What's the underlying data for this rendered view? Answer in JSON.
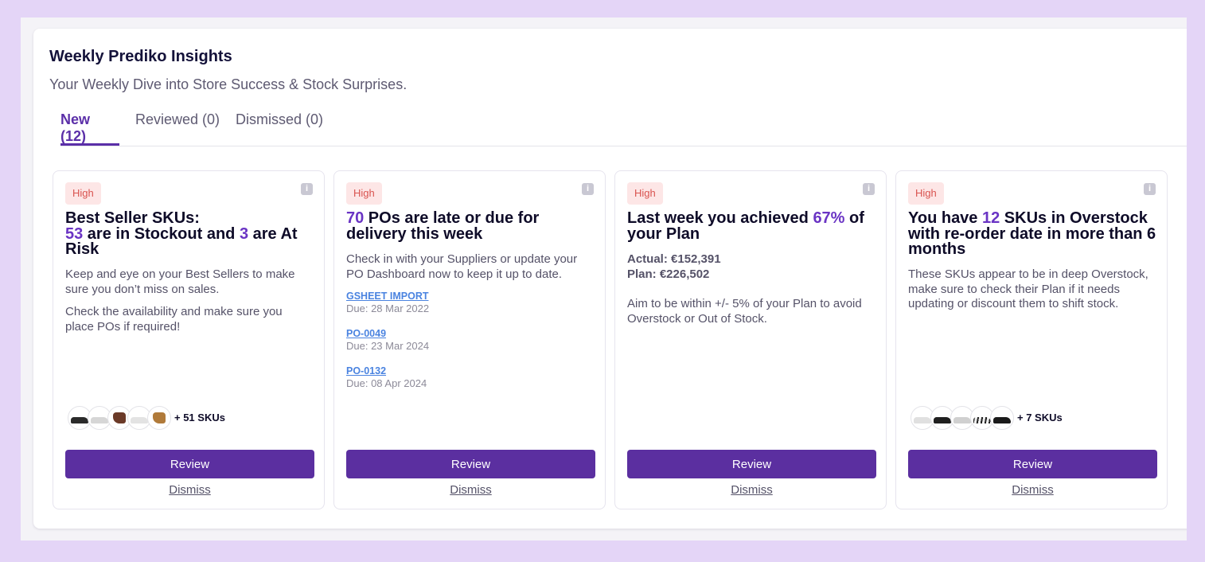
{
  "panel": {
    "title": "Weekly Prediko Insights",
    "subtitle": "Your Weekly Dive into Store Success & Stock Surprises."
  },
  "tabs": [
    {
      "label": "New (12)",
      "active": true
    },
    {
      "label": "Reviewed (0)",
      "active": false
    },
    {
      "label": "Dismissed (0)",
      "active": false
    }
  ],
  "colors": {
    "accent": "#5b2fa8",
    "highlight": "#6a34c4",
    "button": "#5b2fa0",
    "badge_text": "#d9534f",
    "badge_bg": "#fde6e6",
    "link": "#4a83e0"
  },
  "cards": [
    {
      "badge": "High",
      "info_icon": "info-icon",
      "heading": {
        "part1": "Best Seller SKUs:",
        "num1": "53",
        "part2": " are in Stockout and ",
        "num2": "3",
        "part3": " are At Risk"
      },
      "body": [
        "Keep and eye on your Best Sellers to make sure you don’t miss on sales.",
        "Check the availability and make sure you place POs if required!"
      ],
      "more_skus": "+ 51 SKUs",
      "review": "Review",
      "dismiss": "Dismiss"
    },
    {
      "badge": "High",
      "info_icon": "info-icon",
      "heading": {
        "num1": "70",
        "part1": " POs are late or due for delivery this week"
      },
      "body": [
        "Check in with your Suppliers or update your PO Dashboard now to keep it up to date."
      ],
      "pos": [
        {
          "name": "GSHEET IMPORT",
          "due": "Due: 28 Mar 2022"
        },
        {
          "name": "PO-0049",
          "due": "Due: 23 Mar 2024"
        },
        {
          "name": "PO-0132",
          "due": "Due: 08 Apr 2024"
        }
      ],
      "review": "Review",
      "dismiss": "Dismiss"
    },
    {
      "badge": "High",
      "info_icon": "info-icon",
      "heading": {
        "part1": "Last week you achieved ",
        "num1": "67%",
        "part2": " of your Plan"
      },
      "metrics": {
        "actual": "Actual: €152,391",
        "plan": "Plan: €226,502"
      },
      "body": [
        "Aim to be within +/- 5% of your Plan to avoid Overstock or Out of Stock."
      ],
      "review": "Review",
      "dismiss": "Dismiss"
    },
    {
      "badge": "High",
      "info_icon": "info-icon",
      "heading": {
        "part1": "You have ",
        "num1": "12",
        "part2": " SKUs in Overstock with re-order date in more than 6 months"
      },
      "body": [
        "These SKUs appear to be in deep Overstock, make sure to check their Plan if it needs updating or discount them to shift stock."
      ],
      "more_skus": "+ 7 SKUs",
      "review": "Review",
      "dismiss": "Dismiss"
    }
  ]
}
